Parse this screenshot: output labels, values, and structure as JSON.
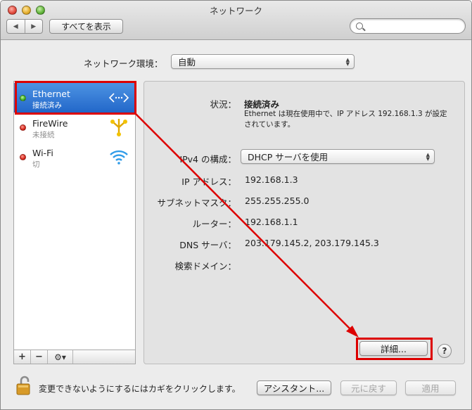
{
  "window": {
    "title": "ネットワーク"
  },
  "toolbar": {
    "back_glyph": "◀",
    "forward_glyph": "▶",
    "show_all_label": "すべてを表示",
    "search_placeholder": ""
  },
  "location": {
    "label": "ネットワーク環境：",
    "value": "自動"
  },
  "sidebar": {
    "services": [
      {
        "name": "Ethernet",
        "status": "接続済み",
        "indicator": "green",
        "icon": "ethernet-icon",
        "selected": true
      },
      {
        "name": "FireWire",
        "status": "未接続",
        "indicator": "red",
        "icon": "firewire-icon",
        "selected": false
      },
      {
        "name": "Wi-Fi",
        "status": "切",
        "indicator": "red",
        "icon": "wifi-icon",
        "selected": false
      }
    ],
    "add_label": "+",
    "remove_label": "−",
    "action_label": "⚙▾"
  },
  "detail": {
    "status_label": "状況：",
    "status_value": "接続済み",
    "status_description": "Ethernet は現在使用中で、IP アドレス 192.168.1.3 が設定されています。",
    "ipv4_label": "IPv4 の構成：",
    "ipv4_value": "DHCP サーバを使用",
    "ip_label": "IP アドレス：",
    "ip_value": "192.168.1.3",
    "subnet_label": "サブネットマスク：",
    "subnet_value": "255.255.255.0",
    "router_label": "ルーター：",
    "router_value": "192.168.1.1",
    "dns_label": "DNS サーバ：",
    "dns_value": "203.179.145.2, 203.179.145.3",
    "search_domain_label": "検索ドメイン：",
    "search_domain_value": "",
    "advanced_label": "詳細...",
    "help_label": "?"
  },
  "footer": {
    "lock_text": "変更できないようにするにはカギをクリックします。",
    "assistant_label": "アシスタント...",
    "revert_label": "元に戻す",
    "apply_label": "適用"
  },
  "colors": {
    "selection": "#2267c9",
    "annotation": "#dd0000",
    "status_green": "#3fae1f",
    "status_red": "#d8271b"
  }
}
